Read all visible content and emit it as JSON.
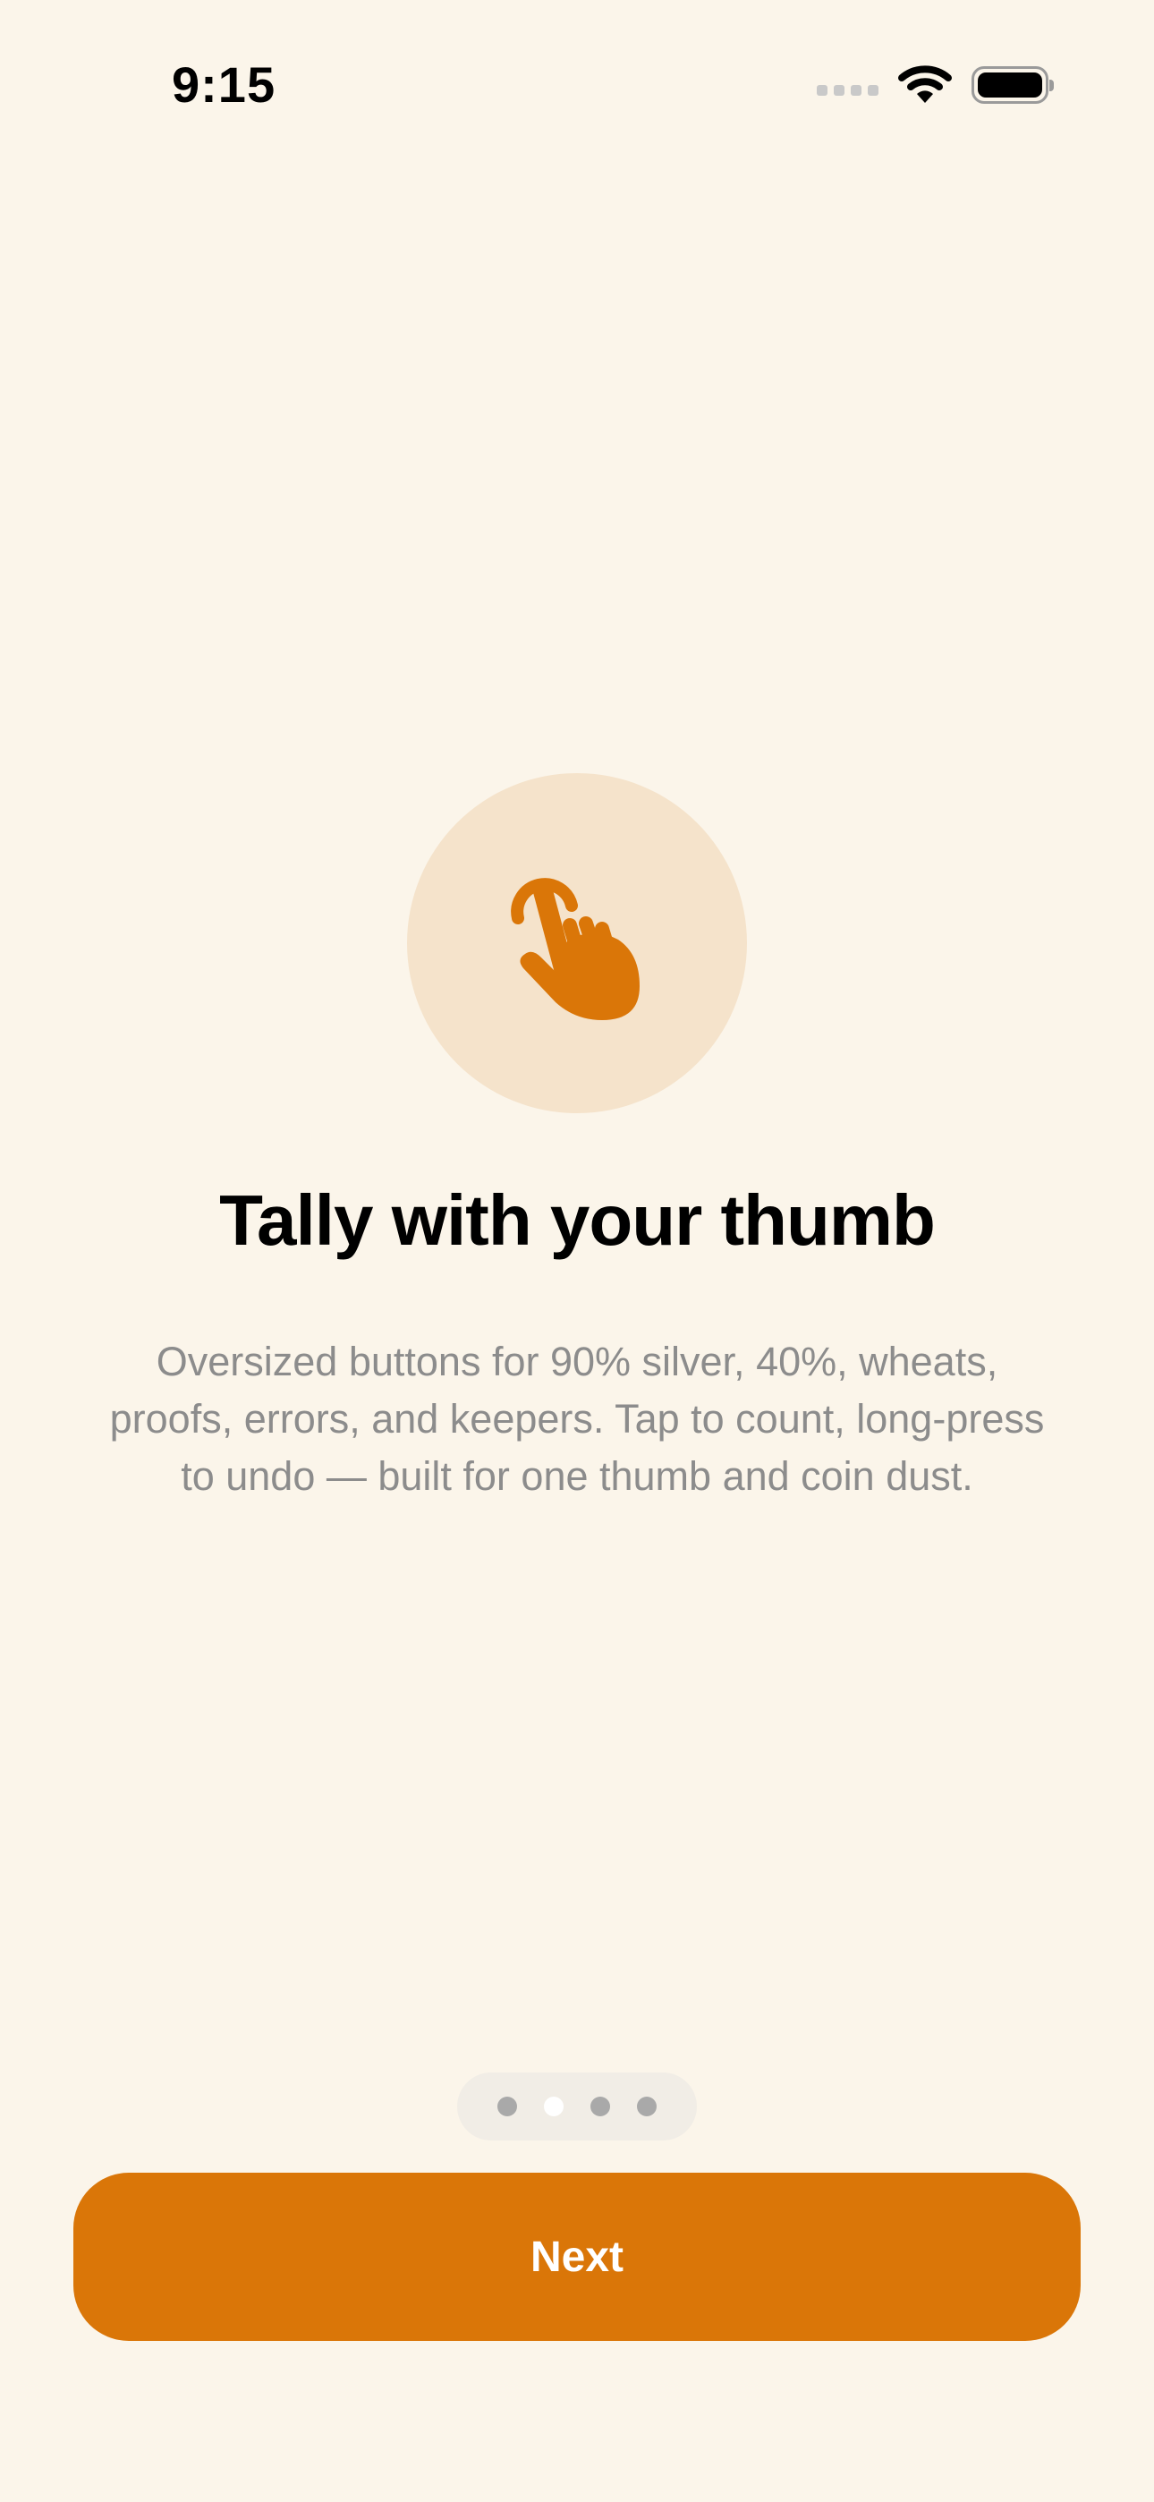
{
  "status_bar": {
    "time": "9:15"
  },
  "onboarding": {
    "icon": "hand-tap-icon",
    "title": "Tally with your thumb",
    "description": "Oversized buttons for 90% silver, 40%, wheats, proofs, errors, and keepers. Tap to count, long-press to undo — built for one thumb and coin dust."
  },
  "pager": {
    "total_pages": 4,
    "current_page": 2
  },
  "actions": {
    "next_label": "Next"
  },
  "colors": {
    "background": "#FBF5EA",
    "accent": "#DA7608",
    "icon_circle": "#F5E3CB",
    "body_text": "#8C8C8C"
  }
}
